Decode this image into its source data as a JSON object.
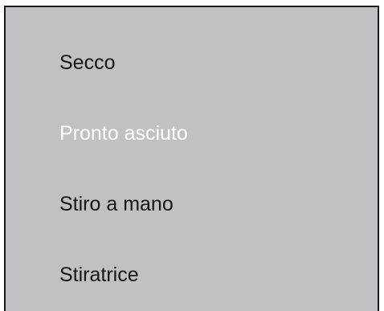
{
  "menu": {
    "selected_index": 1,
    "colors": {
      "background": "#c1c1c3",
      "text": "#161616",
      "selected_text": "#ffffff",
      "border": "#1a1a1a"
    },
    "options": [
      {
        "label": "Secco"
      },
      {
        "label": "Pronto asciuto"
      },
      {
        "label": "Stiro a mano"
      },
      {
        "label": "Stiratrice"
      }
    ]
  }
}
